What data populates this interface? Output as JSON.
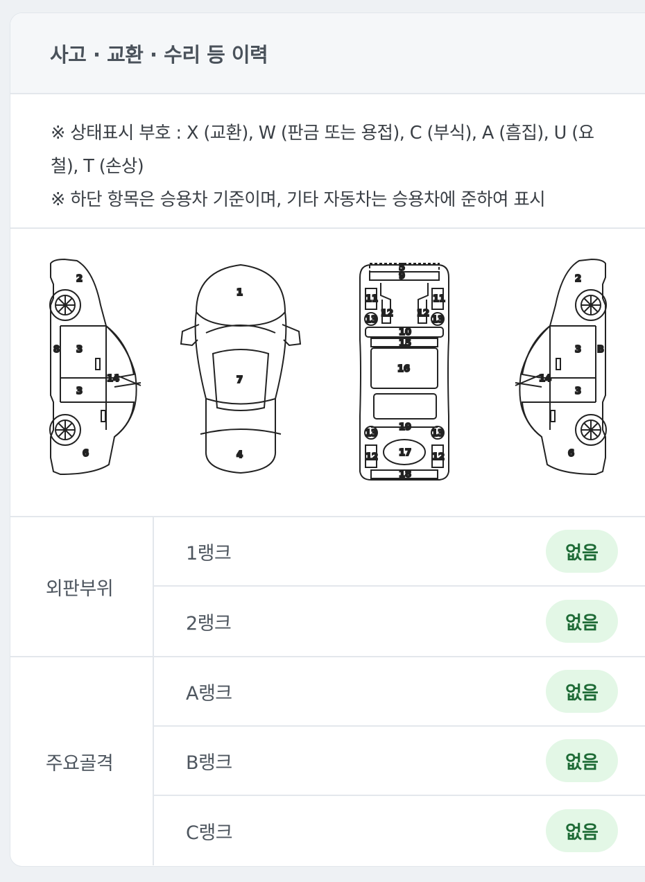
{
  "card": {
    "title": "사고 · 교환 · 수리 등 이력"
  },
  "legend": {
    "line1": "※ 상태표시 부호 : X (교환), W (판금 또는 용접), C (부식), A (흠집), U (요철), T (손상)",
    "line2": "※ 하단 항목은 승용차 기준이며, 기타 자동차는 승용차에 준하여 표시"
  },
  "diagram": {
    "left_side": [
      "2",
      "8",
      "3",
      "3",
      "14",
      "6"
    ],
    "top_view": [
      "1",
      "7",
      "4"
    ],
    "underbody": [
      "5",
      "9",
      "11",
      "11",
      "12",
      "12",
      "13",
      "13",
      "10",
      "15",
      "16",
      "19",
      "13",
      "13",
      "12",
      "17",
      "12",
      "18"
    ],
    "right_side": [
      "2",
      "3",
      "B",
      "14",
      "3",
      "6"
    ]
  },
  "groups": [
    {
      "label": "외판부위",
      "rows": [
        {
          "rank": "1랭크",
          "status": "없음"
        },
        {
          "rank": "2랭크",
          "status": "없음"
        }
      ]
    },
    {
      "label": "주요골격",
      "rows": [
        {
          "rank": "A랭크",
          "status": "없음"
        },
        {
          "rank": "B랭크",
          "status": "없음"
        },
        {
          "rank": "C랭크",
          "status": "없음"
        }
      ]
    }
  ],
  "colors": {
    "badge_bg": "#e3f7e6",
    "badge_text": "#1e6b36",
    "header_bg": "#f5f7f9"
  }
}
